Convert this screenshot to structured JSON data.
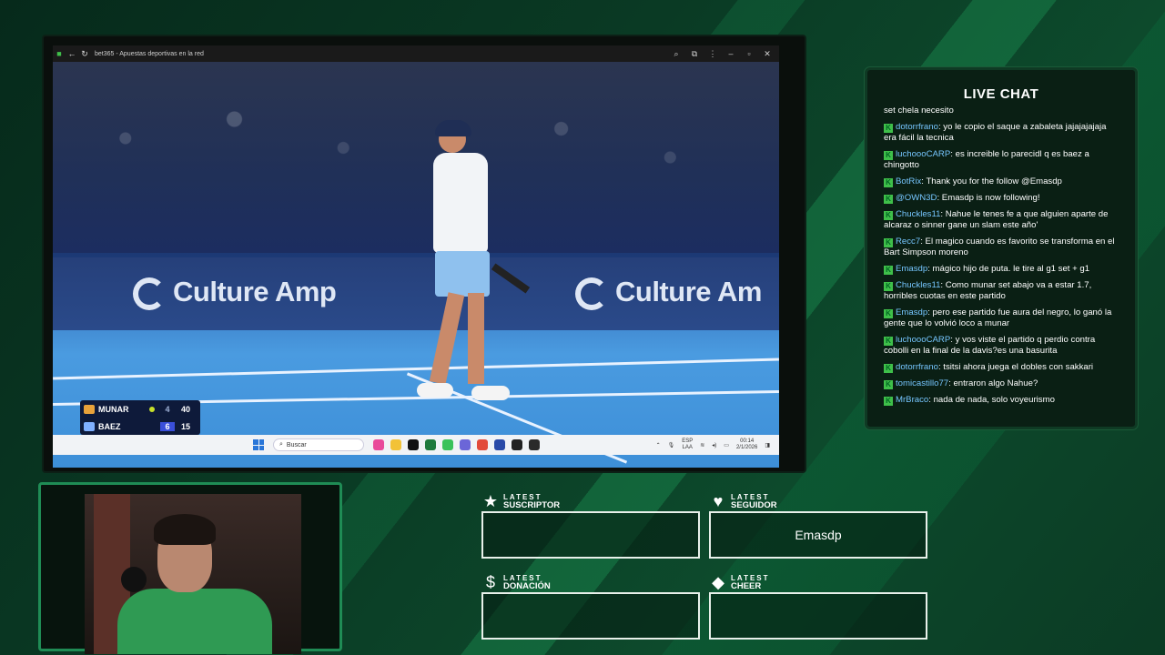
{
  "browser": {
    "tab_title": "bet365 - Apuestas deportivas en la red",
    "ads": [
      "Culture Amp",
      "Culture Am"
    ]
  },
  "scoreboard": {
    "players": [
      {
        "name": "MUNAR",
        "games": "4",
        "points": "40",
        "serving": true,
        "logo_color": "#e8a23a"
      },
      {
        "name": "BAEZ",
        "games": "6",
        "points": "15",
        "serving": false,
        "logo_color": "#7fb0ff"
      }
    ]
  },
  "taskbar": {
    "search_placeholder": "Buscar",
    "lang_top": "ESP",
    "lang_bottom": "LAA",
    "time": "00:14",
    "date": "2/1/2026"
  },
  "chat": {
    "title": "LIVE CHAT",
    "messages": [
      {
        "user": "",
        "text": "set chela necesito",
        "badge": false
      },
      {
        "user": "dotorrfrano",
        "text": "yo le copio el saque a zabaleta jajajajajaja era fácil la tecnica",
        "badge": true
      },
      {
        "user": "luchoooCARP",
        "text": "es increible lo parecidl q es baez a chingotto",
        "badge": true
      },
      {
        "user": "BotRix",
        "text": "Thank you for the follow @Emasdp",
        "badge": true
      },
      {
        "user": "@OWN3D",
        "text": "Emasdp is now following!",
        "badge": true
      },
      {
        "user": "Chuckles11",
        "text": "Nahue le tenes fe a que alguien aparte de alcaraz o sinner gane un slam este año'",
        "badge": true
      },
      {
        "user": "Recc7",
        "text": "El magico cuando es favorito se transforma en el Bart Simpson moreno",
        "badge": true
      },
      {
        "user": "Emasdp",
        "text": "mágico hijo de puta. le tire al g1 set + g1",
        "badge": true
      },
      {
        "user": "Chuckles11",
        "text": "Como munar set abajo va a estar 1.7, horribles cuotas en este partido",
        "badge": true
      },
      {
        "user": "Emasdp",
        "text": "pero ese partido fue aura del negro, lo ganó la gente que lo volvió loco a munar",
        "badge": true
      },
      {
        "user": "luchoooCARP",
        "text": "y vos viste el partido q perdio contra cobolli en la final de la davis?es una basurita",
        "badge": true
      },
      {
        "user": "dotorrfrano",
        "text": "tsitsi ahora juega el dobles con sakkari",
        "badge": true
      },
      {
        "user": "tomicastillo77",
        "text": "entraron algo Nahue?",
        "badge": true
      },
      {
        "user": "MrBraco",
        "text": "nada de nada, solo voyeurismo",
        "badge": true
      }
    ]
  },
  "latest": {
    "suscriptor": {
      "small": "LATEST",
      "big": "SUSCRIPTOR",
      "value": "",
      "icon": "star-icon"
    },
    "seguidor": {
      "small": "LATEST",
      "big": "SEGUIDOR",
      "value": "Emasdp",
      "icon": "heart-icon"
    },
    "donacion": {
      "small": "LATEST",
      "big": "DONACIÓN",
      "value": "",
      "icon": "dollar-icon"
    },
    "cheer": {
      "small": "LATEST",
      "big": "CHEER",
      "value": "",
      "icon": "diamond-icon"
    }
  }
}
